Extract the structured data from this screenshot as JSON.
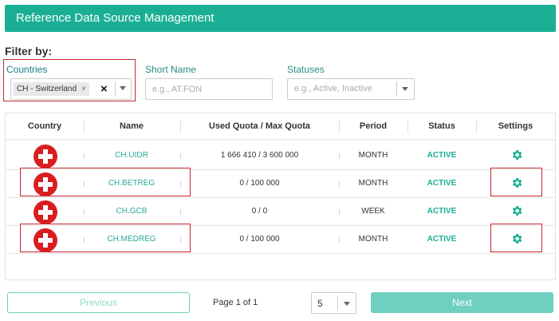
{
  "header": {
    "title": "Reference Data Source Management"
  },
  "filters": {
    "heading": "Filter by:",
    "countries": {
      "label": "Countries",
      "selected_chip": "CH - Switzerland",
      "chip_remove": "×",
      "clear": "×"
    },
    "short_name": {
      "label": "Short Name",
      "placeholder": "e.g., AT.FON",
      "value": ""
    },
    "statuses": {
      "label": "Statuses",
      "placeholder": "e.g., Active, Inactive"
    }
  },
  "table": {
    "columns": [
      "Country",
      "Name",
      "Used Quota / Max Quota",
      "Period",
      "Status",
      "Settings"
    ],
    "rows": [
      {
        "country": "CH",
        "name": "CH.UIDR",
        "quota": "1 666 410 / 3 600 000",
        "period": "MONTH",
        "status": "ACTIVE",
        "highlighted": false
      },
      {
        "country": "CH",
        "name": "CH.BETREG",
        "quota": "0 / 100 000",
        "period": "MONTH",
        "status": "ACTIVE",
        "highlighted": true
      },
      {
        "country": "CH",
        "name": "CH.GCB",
        "quota": "0 / 0",
        "period": "WEEK",
        "status": "ACTIVE",
        "highlighted": false
      },
      {
        "country": "CH",
        "name": "CH.MEDREG",
        "quota": "0 / 100 000",
        "period": "MONTH",
        "status": "ACTIVE",
        "highlighted": true
      }
    ]
  },
  "pagination": {
    "previous_label": "Previous",
    "page_info": "Page 1 of 1",
    "page_size": "5",
    "next_label": "Next"
  },
  "colors": {
    "accent": "#1aaf95",
    "highlight_border": "#c2272d",
    "flag_red": "#d81e22"
  },
  "icons": {
    "flag": "swiss-flag-icon",
    "settings": "gear-icon",
    "dropdown": "chevron-down-icon"
  }
}
